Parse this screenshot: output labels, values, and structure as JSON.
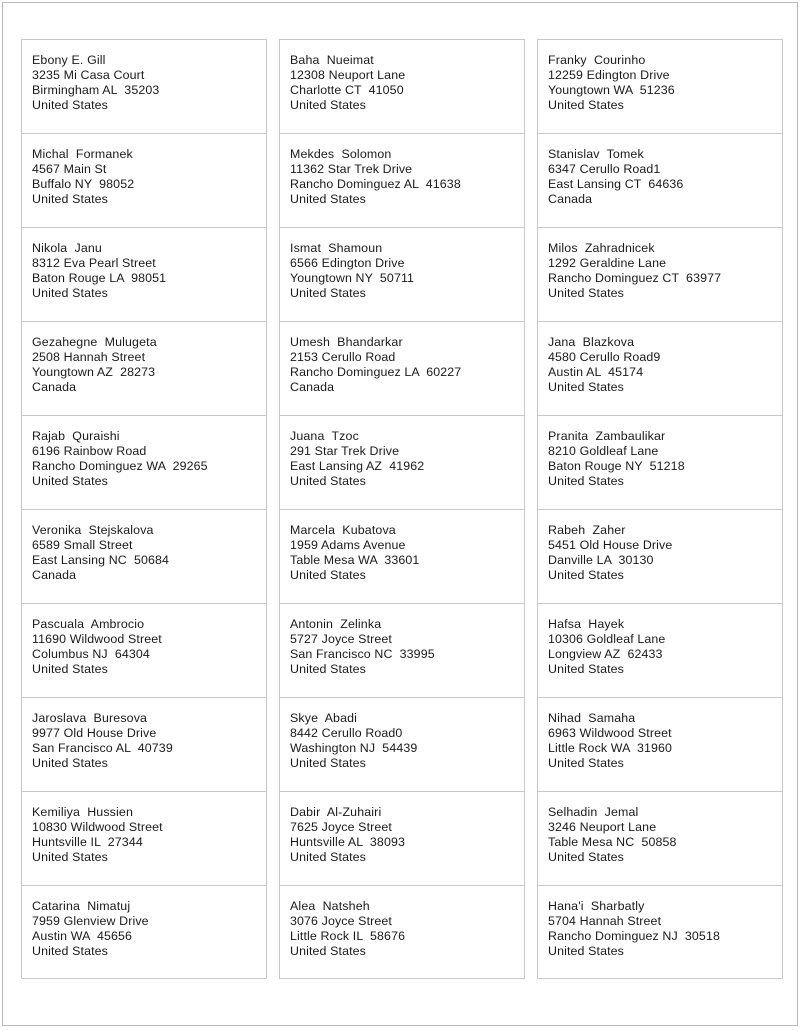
{
  "document": {
    "type": "address-label-sheet",
    "columns": 3,
    "rows": 11,
    "page_border_color": "#b9b9b9",
    "label_border_color": "#c8c8c8",
    "text_color": "#1a1a1a",
    "background_color": "#ffffff"
  },
  "labels": [
    [
      {
        "name": "Ebony E. Gill",
        "street": "3235 Mi Casa Court",
        "citystatezip": "Birmingham AL  35203",
        "country": "United States"
      },
      {
        "name": "Michal  Formanek",
        "street": "4567 Main St",
        "citystatezip": "Buffalo NY  98052",
        "country": "United States"
      },
      {
        "name": "Nikola  Janu",
        "street": "8312 Eva Pearl Street",
        "citystatezip": "Baton Rouge LA  98051",
        "country": "United States"
      },
      {
        "name": "Gezahegne  Mulugeta",
        "street": "2508 Hannah Street",
        "citystatezip": "Youngtown AZ  28273",
        "country": "Canada"
      },
      {
        "name": "Rajab  Quraishi",
        "street": "6196 Rainbow Road",
        "citystatezip": "Rancho Dominguez WA  29265",
        "country": "United States"
      },
      {
        "name": "Veronika  Stejskalova",
        "street": "6589 Small Street",
        "citystatezip": "East Lansing NC  50684",
        "country": "Canada"
      },
      {
        "name": "Pascuala  Ambrocio",
        "street": "11690 Wildwood Street",
        "citystatezip": "Columbus NJ  64304",
        "country": "United States"
      },
      {
        "name": "Jaroslava  Buresova",
        "street": "9977 Old House Drive",
        "citystatezip": "San Francisco AL  40739",
        "country": "United States"
      },
      {
        "name": "Kemiliya  Hussien",
        "street": "10830 Wildwood Street",
        "citystatezip": "Huntsville IL  27344",
        "country": "United States"
      },
      {
        "name": "Catarina  Nimatuj",
        "street": "7959 Glenview Drive",
        "citystatezip": "Austin WA  45656",
        "country": "United States"
      }
    ],
    [
      {
        "name": "Baha  Nueimat",
        "street": "12308 Neuport Lane",
        "citystatezip": "Charlotte CT  41050",
        "country": "United States"
      },
      {
        "name": "Mekdes  Solomon",
        "street": "11362 Star Trek Drive",
        "citystatezip": "Rancho Dominguez AL  41638",
        "country": "United States"
      },
      {
        "name": "Ismat  Shamoun",
        "street": "6566 Edington Drive",
        "citystatezip": "Youngtown NY  50711",
        "country": "United States"
      },
      {
        "name": "Umesh  Bhandarkar",
        "street": "2153 Cerullo Road",
        "citystatezip": "Rancho Dominguez LA  60227",
        "country": "Canada"
      },
      {
        "name": "Juana  Tzoc",
        "street": "291 Star Trek Drive",
        "citystatezip": "East Lansing AZ  41962",
        "country": "United States"
      },
      {
        "name": "Marcela  Kubatova",
        "street": "1959 Adams Avenue",
        "citystatezip": "Table Mesa WA  33601",
        "country": "United States"
      },
      {
        "name": "Antonin  Zelinka",
        "street": "5727 Joyce Street",
        "citystatezip": "San Francisco NC  33995",
        "country": "United States"
      },
      {
        "name": "Skye  Abadi",
        "street": "8442 Cerullo Road0",
        "citystatezip": "Washington NJ  54439",
        "country": "United States"
      },
      {
        "name": "Dabir  Al-Zuhairi",
        "street": "7625 Joyce Street",
        "citystatezip": "Huntsville AL  38093",
        "country": "United States"
      },
      {
        "name": "Alea  Natsheh",
        "street": "3076 Joyce Street",
        "citystatezip": "Little Rock IL  58676",
        "country": "United States"
      }
    ],
    [
      {
        "name": "Franky  Courinho",
        "street": "12259 Edington Drive",
        "citystatezip": "Youngtown WA  51236",
        "country": "United States"
      },
      {
        "name": "Stanislav  Tomek",
        "street": "6347 Cerullo Road1",
        "citystatezip": "East Lansing CT  64636",
        "country": "Canada"
      },
      {
        "name": "Milos  Zahradnicek",
        "street": "1292 Geraldine Lane",
        "citystatezip": "Rancho Dominguez CT  63977",
        "country": "United States"
      },
      {
        "name": "Jana  Blazkova",
        "street": "4580 Cerullo Road9",
        "citystatezip": "Austin AL  45174",
        "country": "United States"
      },
      {
        "name": "Pranita  Zambaulikar",
        "street": "8210 Goldleaf Lane",
        "citystatezip": "Baton Rouge NY  51218",
        "country": "United States"
      },
      {
        "name": "Rabeh  Zaher",
        "street": "5451 Old House Drive",
        "citystatezip": "Danville LA  30130",
        "country": "United States"
      },
      {
        "name": "Hafsa  Hayek",
        "street": "10306 Goldleaf Lane",
        "citystatezip": "Longview AZ  62433",
        "country": "United States"
      },
      {
        "name": "Nihad  Samaha",
        "street": "6963 Wildwood Street",
        "citystatezip": "Little Rock WA  31960",
        "country": "United States"
      },
      {
        "name": "Selhadin  Jemal",
        "street": "3246 Neuport Lane",
        "citystatezip": "Table Mesa NC  50858",
        "country": "United States"
      },
      {
        "name": "Hana'i  Sharbatly",
        "street": "5704 Hannah Street",
        "citystatezip": "Rancho Dominguez NJ  30518",
        "country": "United States"
      }
    ]
  ]
}
